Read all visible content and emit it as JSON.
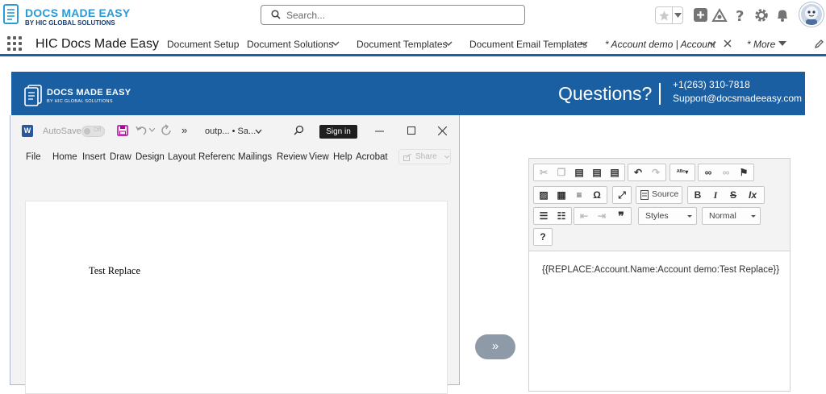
{
  "header": {
    "logo_title": "DOCS MADE EASY",
    "logo_subtitle": "BY HIC GLOBAL SOLUTIONS",
    "search_placeholder": "Search...",
    "icons": [
      "star-icon",
      "chevron-down-icon",
      "add-icon",
      "trailhead-icon",
      "help-icon",
      "gear-icon",
      "bell-icon",
      "avatar"
    ]
  },
  "nav": {
    "app_name": "HIC Docs Made Easy",
    "items": [
      {
        "label": "Document Setup",
        "has_menu": false
      },
      {
        "label": "Document Solutions",
        "has_menu": true
      },
      {
        "label": "Document Templates",
        "has_menu": true
      },
      {
        "label": "Document Email Templates",
        "has_menu": true
      },
      {
        "label": "* Account demo | Account",
        "has_menu": true
      },
      {
        "label": "* More",
        "has_menu": true
      }
    ],
    "accent_color": "#1b5fab"
  },
  "banner": {
    "logo_title": "DOCS MADE EASY",
    "logo_subtitle": "BY HIC GLOBAL SOLUTIONS",
    "questions": "Questions?",
    "phone": "+1(263) 310-7818",
    "email": "Support@docsmadeeasy.com",
    "background": "#1b5fa3"
  },
  "word": {
    "app_letter": "W",
    "autosave": "AutoSave",
    "autosave_state": "Off",
    "more": "»",
    "filename": "outp... • Sa...",
    "sign_in": "Sign in",
    "ribbon": [
      "File",
      "Home",
      "Insert",
      "Draw",
      "Design",
      "Layout",
      "Referenc",
      "Mailings",
      "Review",
      "View",
      "Help",
      "Acrobat"
    ],
    "share": "Share",
    "document_text": "Test Replace"
  },
  "transfer_button": "»",
  "editor": {
    "source": "Source",
    "styles": "Styles",
    "format": "Normal",
    "help": "?",
    "content": "{{REPLACE:Account.Name:Account demo:Test Replace}}"
  }
}
